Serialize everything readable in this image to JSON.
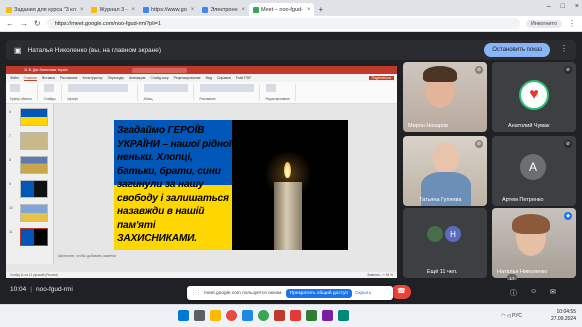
{
  "browser": {
    "tabs": [
      {
        "label": "Задания для курса \"3 кл",
        "active": false,
        "color": "#fbbc04"
      },
      {
        "label": "Журнал 3 -",
        "active": false,
        "color": "#fbbc04"
      },
      {
        "label": "https://www.go",
        "active": false,
        "color": "#4285f4"
      },
      {
        "label": "Электронн",
        "active": false,
        "color": "#4285f4"
      },
      {
        "label": "Meet – noo-fgud-",
        "active": true,
        "color": "#34a853"
      }
    ],
    "url": "https://meet.google.com/noo-fgud-rmi?pli=1",
    "incognito_label": "Инкогнито"
  },
  "presenter_bar": {
    "label": "Наталья Николенко (вы, на главном экране)",
    "stop_button": "Остановить показ"
  },
  "shared_screen": {
    "app_title": "11 В. Дім Захисника Україн",
    "menu": [
      "Файл",
      "Главная",
      "Вставка",
      "Рисование",
      "Конструктор",
      "Переходы",
      "Анимация",
      "Слайд-шоу",
      "Рецензирование",
      "Вид",
      "Справка",
      "Foxit PDF"
    ],
    "share_label": "Поделиться",
    "ribbon_groups": [
      "Буфер обмена",
      "Слайды",
      "Шрифт",
      "Абзац",
      "Рисование",
      "Редактирование"
    ],
    "slide_numbers": [
      "6",
      "7",
      "8",
      "9",
      "10",
      "11"
    ],
    "slide_text": "Згадаймо ГЕРОЇВ УКРАЇНИ – нашої рідної неньки. Хлопці, батьки, брати, сини загинули за нашу свободу і залишаться назавжди в нашій пам'яті ЗАХИСНИКАМИ.",
    "notes_placeholder": "Щёлкните, чтобы добавить заметки",
    "status_left": "Слайд 11 из 11   русский (Россия)",
    "status_right": "Заметки   –   +   64 %"
  },
  "participants": [
    {
      "name": "Мирон Назаров",
      "mic_off": true
    },
    {
      "name": "Анатолий Чумак",
      "mic_off": true
    },
    {
      "name": "Татьяна Гуляева",
      "mic_off": true
    },
    {
      "name": "Артем Петренко",
      "mic_off": true,
      "avatar_letter": "А"
    },
    {
      "name": "Ещё 11 чел.",
      "avatar_letter": "Н"
    },
    {
      "name": "Наталья Николенко",
      "mic_off": false
    }
  ],
  "call": {
    "time": "10:04",
    "meeting_code": "noo-fgud-rmi",
    "people_count": "17"
  },
  "notification": {
    "message": "meet.google.com пользуется окном.",
    "stop_button": "Прекратить общий доступ",
    "hide": "Скрыть"
  },
  "taskbar": {
    "clock_time": "10:04:55",
    "clock_date": "27.09.2024",
    "lang": "РУС"
  }
}
